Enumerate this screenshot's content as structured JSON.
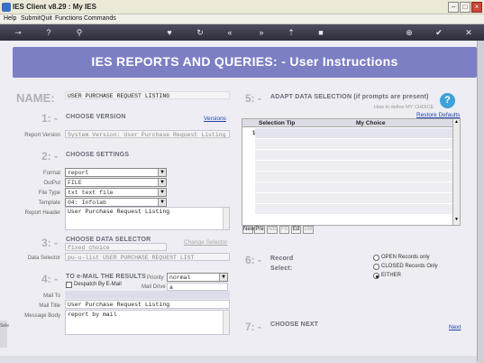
{
  "window": {
    "title": "IES Client v8.29 : My IES"
  },
  "menu": [
    "Help",
    "Submit",
    "Quit",
    "Functions",
    "Commands"
  ],
  "header": {
    "title": "IES REPORTS AND QUERIES: -   User Instructions"
  },
  "name": {
    "label": "NAME:",
    "value": "USER PURCHASE REQUEST LISTING"
  },
  "step1": {
    "num": "1: -",
    "title": "CHOOSE VERSION",
    "versions_link": "Versions",
    "report_version_label": "Report Version",
    "report_version_value": "System Version: User Purchase Request Listing"
  },
  "step2": {
    "num": "2: -",
    "title": "CHOOSE SETTINGS",
    "format_label": "Format",
    "format_value": "report",
    "output_label": "OutPut",
    "output_value": "FILE",
    "filetype_label": "File Type",
    "filetype_value": "txt text file",
    "template_label": "Template",
    "template_value": "04: Infolab",
    "reportheader_label": "Report Header",
    "reportheader_value": "User Purchase Request Listing"
  },
  "step3": {
    "num": "3: -",
    "title": "CHOOSE DATA SELECTOR",
    "change_link": "Change Selector",
    "fixed_value": "fixed choice",
    "selector_label": "Data Selector",
    "selector_value": "pu-u-list USER PURCHASE REQUEST LIST"
  },
  "step4": {
    "num": "4: -",
    "title": "TO e-MAIL THE RESULTS",
    "priority_label": "Priority",
    "priority_value": "normal",
    "despatch_label": "Despatch By E-Mail",
    "maildrive_label": "Mail Drive",
    "maildrive_value": "a",
    "mailto_label": "Mail To",
    "mailtitle_label": "Mail Title",
    "mailtitle_value": "User Purchase Request Listing",
    "mailbody_label": "Message Body",
    "mailbody_value": "report by mail"
  },
  "step5": {
    "num": "5: -",
    "title": "ADAPT DATA SELECTION (if prompts are present)",
    "howto": "How to define MY CHOICE",
    "restore_link": "Restore Defaults",
    "col_tip": "Selection Tip",
    "col_choice": "My Choice",
    "first_row_num": "1",
    "nav": [
      "New",
      "Pre",
      "Add",
      "Fo",
      "Ed",
      "Del"
    ]
  },
  "step6": {
    "num": "6: -",
    "title_line1": "Record",
    "title_line2": "Select:",
    "options": [
      "OPEN Records only",
      "CLOSED Records Only",
      "EITHER"
    ],
    "selected": "EITHER"
  },
  "step7": {
    "num": "7: -",
    "title": "CHOOSE NEXT",
    "next_link": "Next"
  },
  "side": {
    "letters": "Sele"
  }
}
